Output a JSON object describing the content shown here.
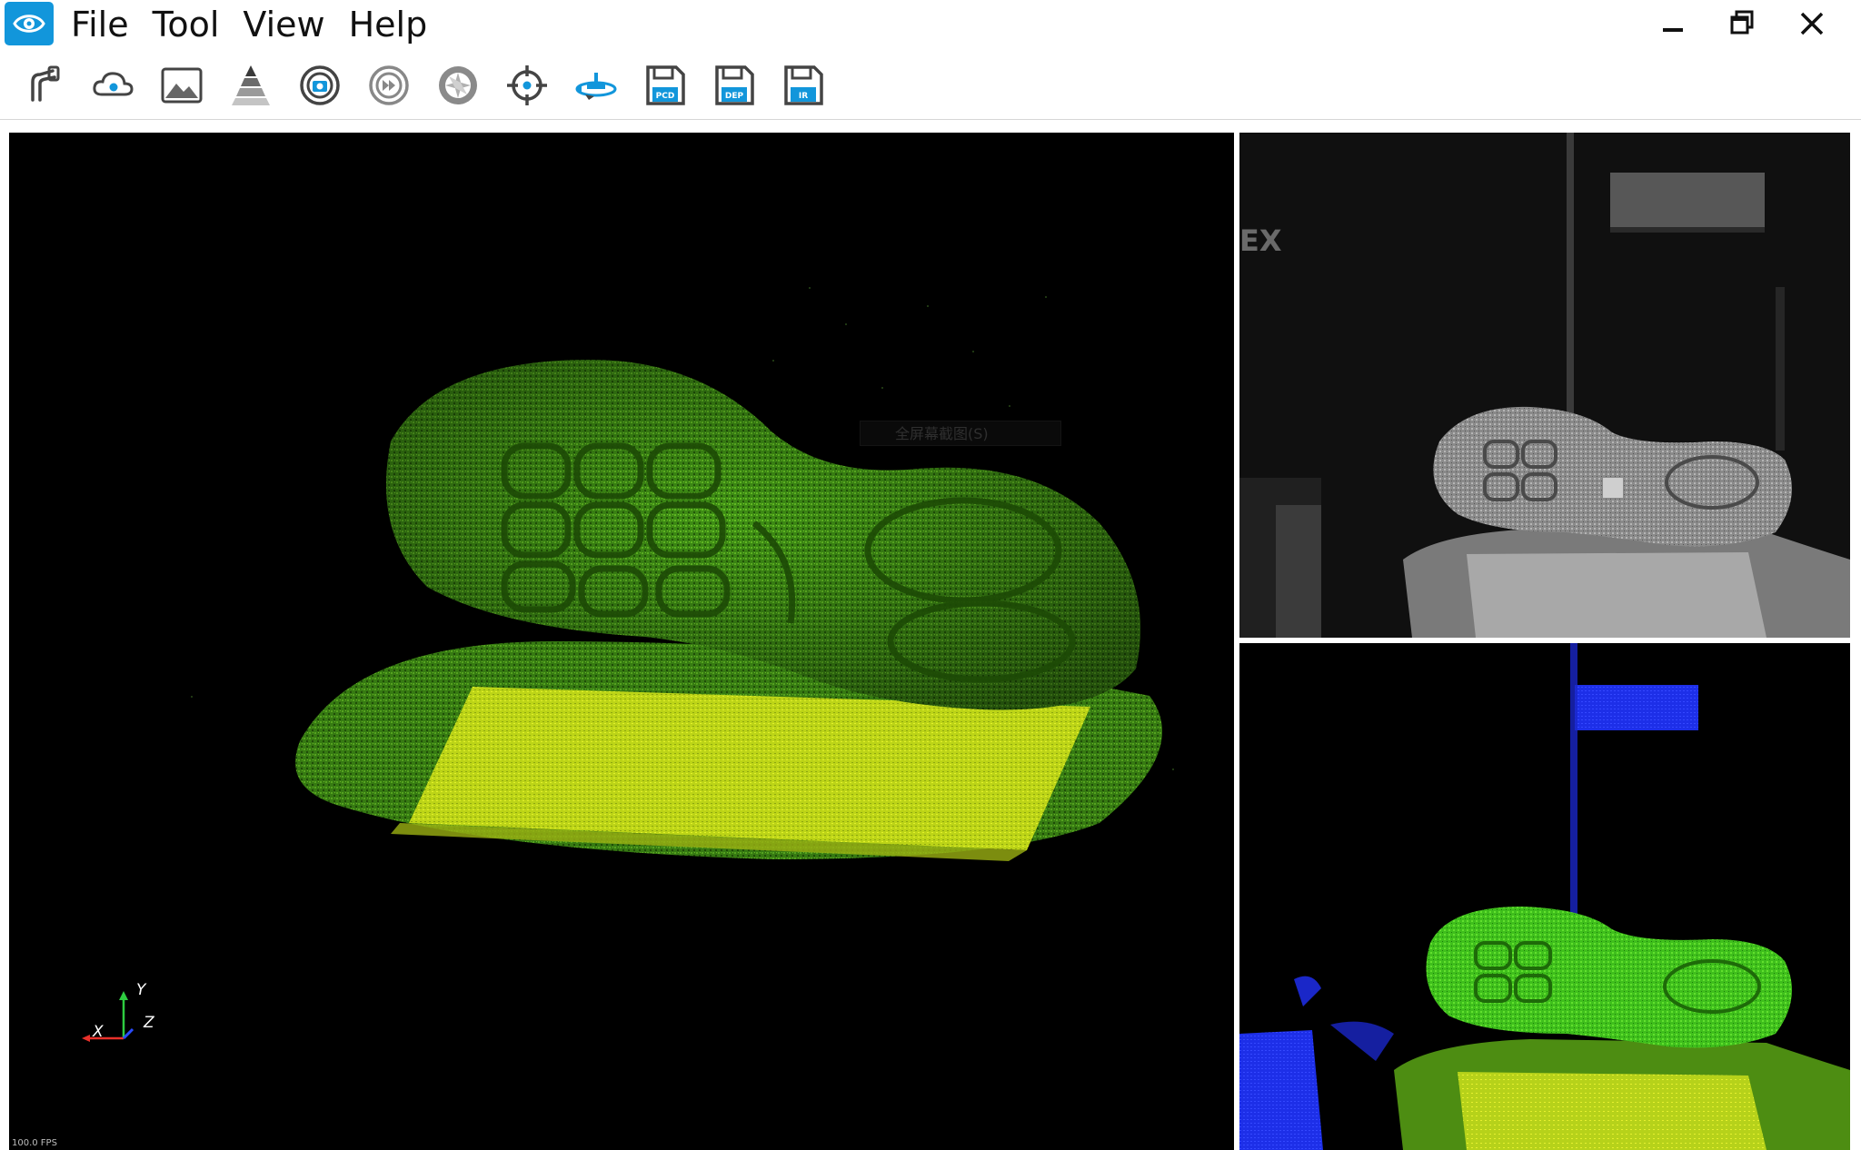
{
  "window": {
    "logo_icon": "eye-icon",
    "controls": {
      "minimize_icon": "minimize-icon",
      "restore_icon": "restore-icon",
      "close_icon": "close-icon"
    }
  },
  "menu": {
    "items": [
      "File",
      "Tool",
      "View",
      "Help"
    ]
  },
  "toolbar": {
    "buttons": [
      {
        "icon": "connect-device-icon"
      },
      {
        "icon": "point-cloud-icon"
      },
      {
        "icon": "image-icon"
      },
      {
        "icon": "depth-layers-icon"
      },
      {
        "icon": "capture-icon"
      },
      {
        "icon": "continuous-capture-icon"
      },
      {
        "icon": "aperture-icon"
      },
      {
        "icon": "target-icon"
      },
      {
        "icon": "rotate-view-icon"
      },
      {
        "icon": "save-pcd-icon",
        "label": "PCD"
      },
      {
        "icon": "save-dep-icon",
        "label": "DEP"
      },
      {
        "icon": "save-ir-icon",
        "label": "IR"
      }
    ]
  },
  "views": {
    "pointcloud": {
      "fps": "100.0 FPS",
      "context_hint": "全屏幕截图(S)",
      "axes": {
        "x": "X",
        "y": "Y",
        "z": "Z"
      }
    },
    "ir": {
      "watermark": "EX"
    }
  },
  "colors": {
    "accent": "#1296db",
    "cloud_green": "#4caf1a",
    "cloud_yellow": "#cfe21a",
    "depth_blue": "#1a2cf0"
  }
}
